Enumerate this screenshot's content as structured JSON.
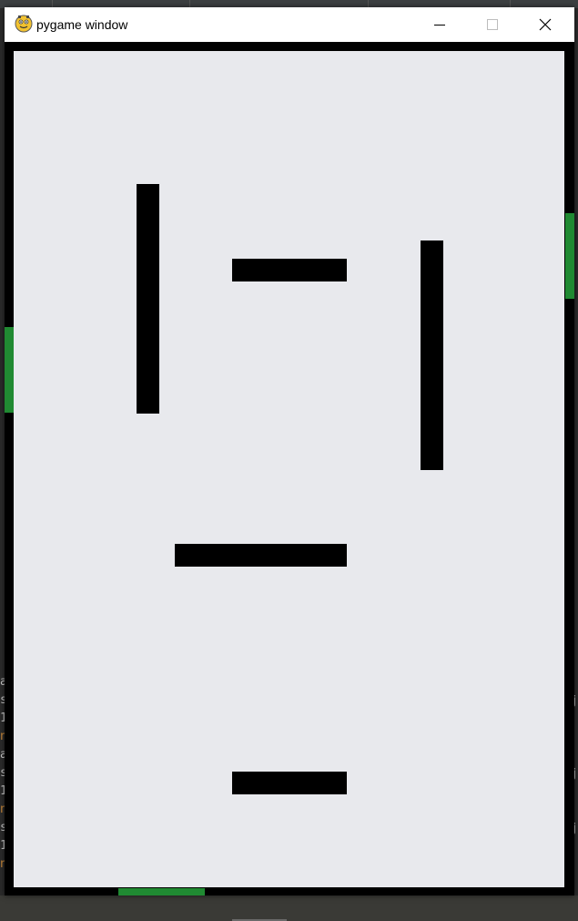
{
  "window": {
    "title": "pygame window",
    "controls": {
      "minimize": "minimize-icon",
      "maximize": "maximize-icon",
      "close": "close-icon"
    }
  },
  "game": {
    "background_color": "#e8e9ed",
    "border_color": "#000000",
    "wall_color": "#000000",
    "exit_marker_color": "#208a32",
    "walls": [
      {
        "orientation": "vertical"
      },
      {
        "orientation": "horizontal"
      },
      {
        "orientation": "vertical"
      },
      {
        "orientation": "horizontal"
      },
      {
        "orientation": "horizontal"
      }
    ],
    "exit_markers": [
      "left",
      "right",
      "bottom"
    ]
  },
  "background": {
    "left_edge_chars": [
      "a",
      "s",
      "1",
      "n",
      "a",
      "s",
      "1",
      "n",
      "s",
      "1",
      "n"
    ],
    "right_edge_chars": [
      "j",
      "j",
      "j"
    ]
  }
}
